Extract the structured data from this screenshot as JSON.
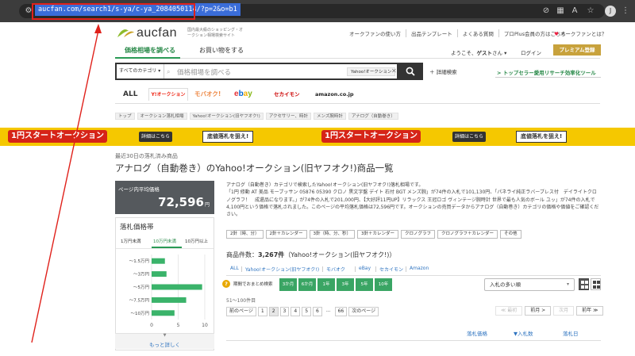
{
  "browser": {
    "url": "aucfan.com/search1/s-ya/c-ya_2084050114/?p=2&o=b1",
    "avatar_letter": "J"
  },
  "header": {
    "logo_text": "aucfan",
    "tagline": "国内最大級のショッピング・オークション相場検索サイト",
    "top_links": [
      "オークファンの使い方",
      "出品テンプレート",
      "よくある質問",
      "プロPlus会員の方はこちら"
    ],
    "favorite": "オークファンとは？",
    "welcome_prefix": "ようこそ、",
    "welcome_user": "ゲスト",
    "welcome_suffix": "さん",
    "login": "ログイン",
    "premium": "プレミアム登録"
  },
  "tabs": {
    "search": "価格相場を調べる",
    "shop": "お買い物をする"
  },
  "search": {
    "category": "すべてのカテゴリ",
    "placeholder": "価格相場を調べる",
    "site_chip": "Yahoo!オークション",
    "button_icon": "search-icon",
    "advanced": "詳細検索",
    "tool_ad": "トップセラー愛用リサーチ効率化ツール"
  },
  "sites": {
    "all": "ALL",
    "yahoo": "Y!オークション",
    "mobaoku": "モバオク!",
    "ebay": "ebay",
    "sekaimon": "セカイモン",
    "amazon": "amazon.co.jp"
  },
  "breadcrumbs": [
    "トップ",
    "オークション落札相場",
    "Yahoo!オークション(旧ヤフオク!)",
    "アクセサリー、時計",
    "メンズ腕時計",
    "アナログ（自動巻き）"
  ],
  "banner": {
    "main": "1円スタートオークション",
    "details": "詳細はこちら",
    "sub": "底値落札を狙え!"
  },
  "page": {
    "subtitle": "最近30日の落札済み商品",
    "title": "アナログ（自動巻き）のYahoo!オークション(旧ヤフオク!)商品一覧"
  },
  "sidebar": {
    "avg_label": "ページ内平均価格",
    "avg_value": "72,596",
    "avg_unit": "円",
    "band_title": "落札価格帯",
    "band_tabs": [
      "1万円未満",
      "10万円未満",
      "10万円以上"
    ],
    "more": "もっと詳しく"
  },
  "chart_data": {
    "type": "bar",
    "orientation": "horizontal",
    "categories": [
      "～1.5万円",
      "～3万円",
      "～5万円",
      "～7.5万円",
      "～10万円"
    ],
    "values": [
      2.5,
      2.8,
      9.5,
      6.5,
      4.3
    ],
    "xlim": [
      0,
      10
    ],
    "xticks": [
      "0",
      "5",
      "10"
    ],
    "grid": true,
    "color": "#3ab36a"
  },
  "description": {
    "line1": "アナログ（自動巻き）カテゴリで検索したYahoo!オークション(旧ヤフオク!)落札相場です。",
    "line2": "「1円 修動 AT 美品 モーブッサン 05876 05390 クロノ 黒文字盤 デイト 石付 BGT メンズ腕」が74件の入札で101,130円、「パネライ純正ラバーブレス付　デイライトクロノグラフ！　成還品になります。」が74件の入札で201,000円、【大好評11円UP】リラックス 王冠ロゴ ヴィンテージ腕時計 世界で最も人気のボール ユッ」が74件の入札で4,100円という価格で落札されました。このページの平均落札価格は72,596円です。オークションの売買データからアナログ（自動巻き）カテゴリの価格や価値をご確認ください。"
  },
  "chips": [
    "2針（時、分）",
    "2針＋カレンダー",
    "3針（時、分、秒）",
    "3針＋カレンダー",
    "クロノグラフ",
    "クロノグラフ＋カレンダー",
    "その他"
  ],
  "results": {
    "count_label": "商品件数：",
    "count_value": "3,267件",
    "count_site": "（Yahoo!オークション(旧ヤフオク!)）",
    "filters": [
      "ALL",
      "Yahoo!オークション(旧ヤフオク!)",
      "モバオク",
      "eBay",
      "セカイモン",
      "Amazon"
    ],
    "period_label": "期間でおまとめ検索",
    "periods": [
      "3か月",
      "6か月",
      "1年",
      "3年",
      "5年",
      "10年"
    ],
    "sort": "入札の多い順",
    "range": "51〜100件目",
    "pages": [
      "前のページ",
      "1",
      "2",
      "3",
      "4",
      "5",
      "6",
      "...",
      "66",
      "次のページ"
    ],
    "right_pager": [
      "≪ 最初",
      "前月 >",
      "次月",
      "前年 ≫"
    ],
    "columns": [
      "落札価格",
      "▼入札数",
      "落札日"
    ]
  }
}
